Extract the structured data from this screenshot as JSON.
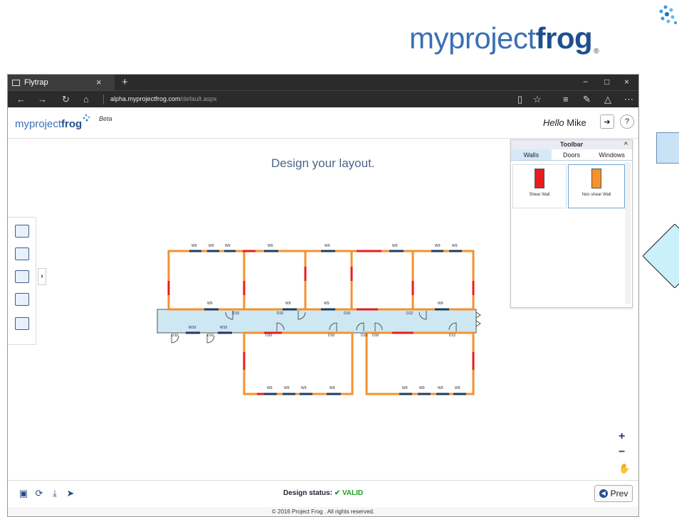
{
  "brand": {
    "part1": "myproject",
    "part2": "frog",
    "reg": "®"
  },
  "browser": {
    "tab_title": "Flytrap",
    "tab_close": "×",
    "new_tab": "+",
    "url_host": "alpha.myprojectfrog.com",
    "url_path": "/default.aspx",
    "win_min": "−",
    "win_max": "□",
    "win_close": "×"
  },
  "app": {
    "logo_part1": "myproject",
    "logo_part2": "frog",
    "beta": "Beta",
    "hello": "Hello",
    "user": "Mike",
    "title": "Design your layout."
  },
  "toolbar": {
    "title": "Toolbar",
    "tabs": [
      "Walls",
      "Doors",
      "Windows"
    ],
    "active_tab": "Walls",
    "items": [
      {
        "label": "Shear Wall",
        "color": "#e81c1c"
      },
      {
        "label": "Non shear Wall",
        "color": "#f5922e"
      }
    ]
  },
  "plan": {
    "windows_top": [
      "W9",
      "W9",
      "W9",
      "W9",
      "W9",
      "W9",
      "W9",
      "W9"
    ],
    "windows_mid": [
      "W9",
      "W9",
      "W9",
      "W9"
    ],
    "corridor_windows": [
      "W10",
      "W10"
    ],
    "doors": [
      "D10",
      "D10",
      "D10",
      "D12",
      "D10",
      "D10",
      "D10",
      "D10",
      "D12",
      "D10",
      "D10"
    ],
    "windows_bottom": [
      "W9",
      "W9",
      "W9",
      "W9",
      "W9",
      "W9",
      "W9",
      "W9"
    ]
  },
  "status": {
    "label": "Design status:",
    "value": "VALID",
    "check": "✔"
  },
  "prev_label": "Prev",
  "footer": "© 2016 Project Frog . All rights reserved.",
  "colors": {
    "shear": "#e81c1c",
    "non_shear": "#f5922e",
    "corridor": "#cde8f3",
    "brand": "#3b6fb6"
  }
}
